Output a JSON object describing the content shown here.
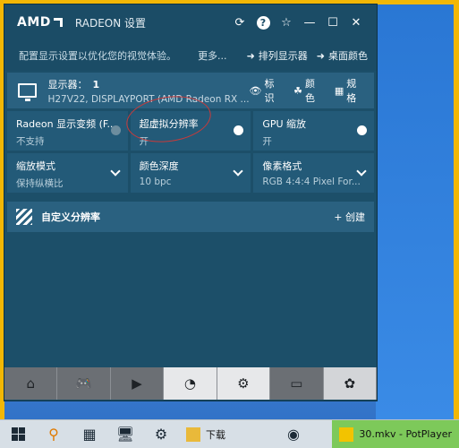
{
  "window": {
    "brand": "AMD",
    "title": "RADEON 设置",
    "controls": {
      "minimize": "—",
      "maximize": "☐",
      "close": "✕"
    }
  },
  "subbar": {
    "hint": "配置显示设置以优化您的视觉体验。",
    "more": "更多...",
    "arrange": "排列显示器",
    "desktop_color": "桌面颜色"
  },
  "display": {
    "label": "显示器：",
    "number": "1",
    "model": "H27V22, DISPLAYPORT (AMD Radeon RX ...",
    "links": {
      "identify": "标识",
      "color": "颜色",
      "specs": "规格"
    }
  },
  "settings": [
    {
      "label": "Radeon 显示变频 (F...",
      "value": "不支持",
      "control": "toggle-off"
    },
    {
      "label": "超虚拟分辨率",
      "value": "开",
      "control": "toggle-on"
    },
    {
      "label": "GPU 缩放",
      "value": "开",
      "control": "toggle-on"
    },
    {
      "label": "缩放模式",
      "value": "保持纵横比",
      "control": "dropdown"
    },
    {
      "label": "颜色深度",
      "value": "10 bpc",
      "control": "dropdown"
    },
    {
      "label": "像素格式",
      "value": "RGB 4:4:4 Pixel For...",
      "control": "dropdown"
    }
  ],
  "custom_resolution": {
    "label": "自定义分辨率",
    "create": "+ 创建"
  },
  "taskbar": {
    "downloads_label": "下载",
    "potplayer_label": "30.mkv - PotPlayer"
  },
  "colors": {
    "accent_annotation": "#c83a3a",
    "taskbar_app_active": "#7dc95a"
  }
}
